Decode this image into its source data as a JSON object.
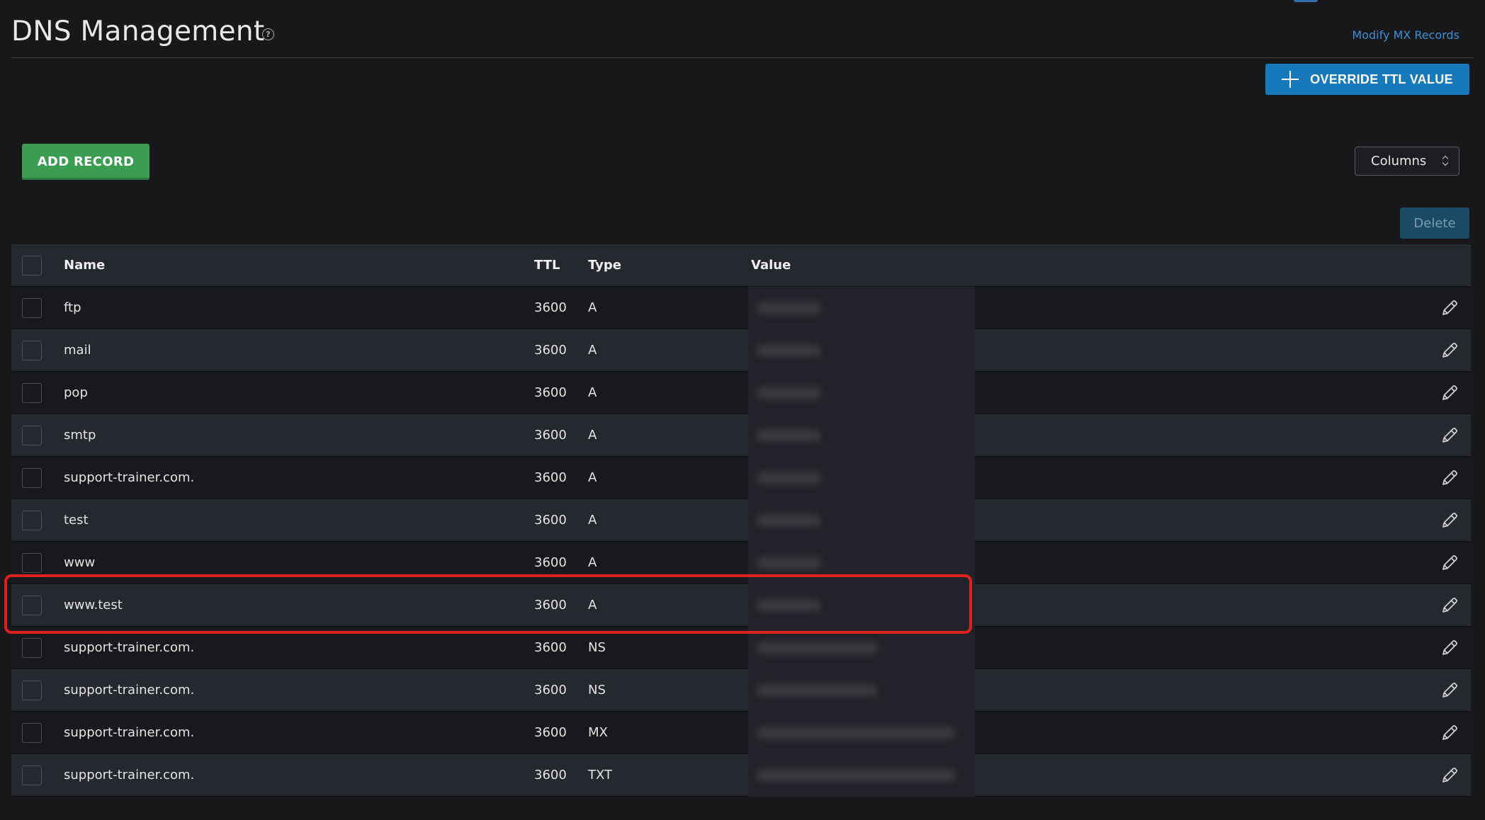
{
  "header": {
    "title": "DNS Management",
    "help_icon": "question-circle-icon",
    "modify_mx_link": "Modify MX Records"
  },
  "actions": {
    "override_ttl_label": "OVERRIDE TTL VALUE",
    "add_record_label": "ADD RECORD",
    "columns_label": "Columns",
    "delete_label": "Delete"
  },
  "table": {
    "columns": [
      "Name",
      "TTL",
      "Type",
      "Value"
    ],
    "rows": [
      {
        "name": "ftp",
        "ttl": "3600",
        "type": "A"
      },
      {
        "name": "mail",
        "ttl": "3600",
        "type": "A"
      },
      {
        "name": "pop",
        "ttl": "3600",
        "type": "A"
      },
      {
        "name": "smtp",
        "ttl": "3600",
        "type": "A"
      },
      {
        "name": "support-trainer.com.",
        "ttl": "3600",
        "type": "A"
      },
      {
        "name": "test",
        "ttl": "3600",
        "type": "A"
      },
      {
        "name": "www",
        "ttl": "3600",
        "type": "A"
      },
      {
        "name": "www.test",
        "ttl": "3600",
        "type": "A"
      },
      {
        "name": "support-trainer.com.",
        "ttl": "3600",
        "type": "NS"
      },
      {
        "name": "support-trainer.com.",
        "ttl": "3600",
        "type": "NS"
      },
      {
        "name": "support-trainer.com.",
        "ttl": "3600",
        "type": "MX"
      },
      {
        "name": "support-trainer.com.",
        "ttl": "3600",
        "type": "TXT"
      }
    ],
    "highlighted_row": "www.test"
  },
  "colors": {
    "background": "#18181b",
    "primary_blue": "#1679bb",
    "add_green": "#3a9d52",
    "highlight_red": "#e0201e",
    "link_blue": "#3b8fd6"
  }
}
